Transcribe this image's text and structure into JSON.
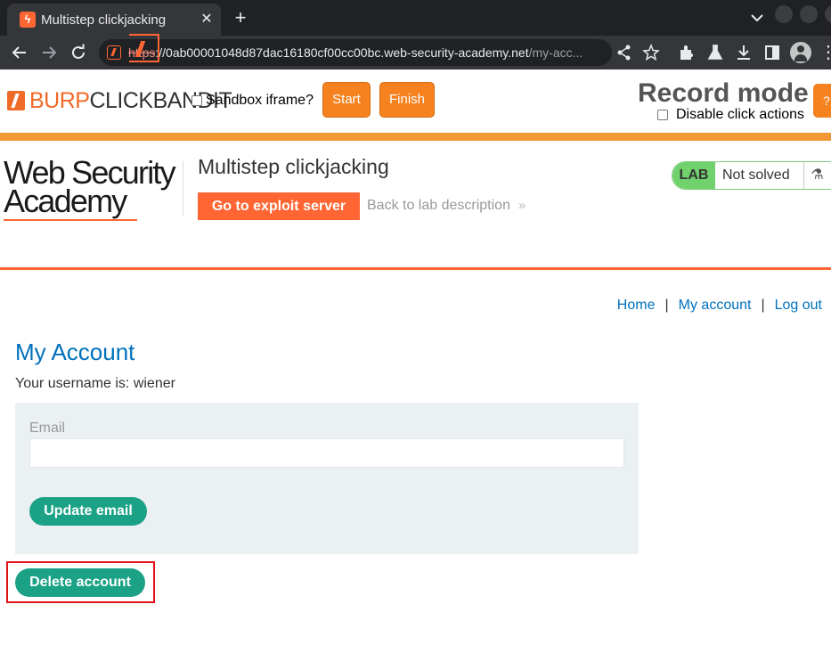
{
  "browser": {
    "tab": {
      "title": "Multistep clickjacking",
      "close": "✕"
    },
    "new_tab": "+",
    "url": {
      "scheme": "https",
      "host": "://0ab00001048d87dac16180cf00cc00bc.web-security-academy.net",
      "path": "/my-acc..."
    },
    "menu": "⋮"
  },
  "clickbandit": {
    "logo_burp": "BURP",
    "logo_clickbandit": "CLICKBANDIT",
    "sandbox_label": "Sandbox iframe?",
    "start_label": "Start",
    "finish_label": "Finish",
    "mode_title": "Record mode",
    "disable_label": "Disable click actions",
    "help_label": "?"
  },
  "lab": {
    "logo_line1": "Web Security",
    "logo_line2": "Academy",
    "title": "Multistep clickjacking",
    "exploit_button": "Go to exploit server",
    "back_link": "Back to lab description",
    "back_chevron": "»",
    "badge_label": "LAB",
    "status": "Not solved",
    "flask": "⚗"
  },
  "nav": {
    "home": "Home",
    "separator": "|",
    "my_account": "My account",
    "logout": "Log out"
  },
  "account": {
    "title": "My Account",
    "username_text": "Your username is: wiener",
    "email_label": "Email",
    "email_value": "",
    "update_button": "Update email",
    "delete_button": "Delete account"
  },
  "colors": {
    "portswigger_orange": "#ff6633",
    "bandit_orange": "#f5811f",
    "link_blue": "#0071bc",
    "button_green": "#1ba286",
    "highlight_red": "#e0131b",
    "lab_green": "#70d16d"
  },
  "icons": [
    "back-arrow-icon",
    "forward-arrow-icon",
    "reload-icon",
    "share-icon",
    "star-icon",
    "extensions-icon",
    "labs-flask-icon",
    "download-icon",
    "sidebar-icon",
    "profile-icon"
  ]
}
